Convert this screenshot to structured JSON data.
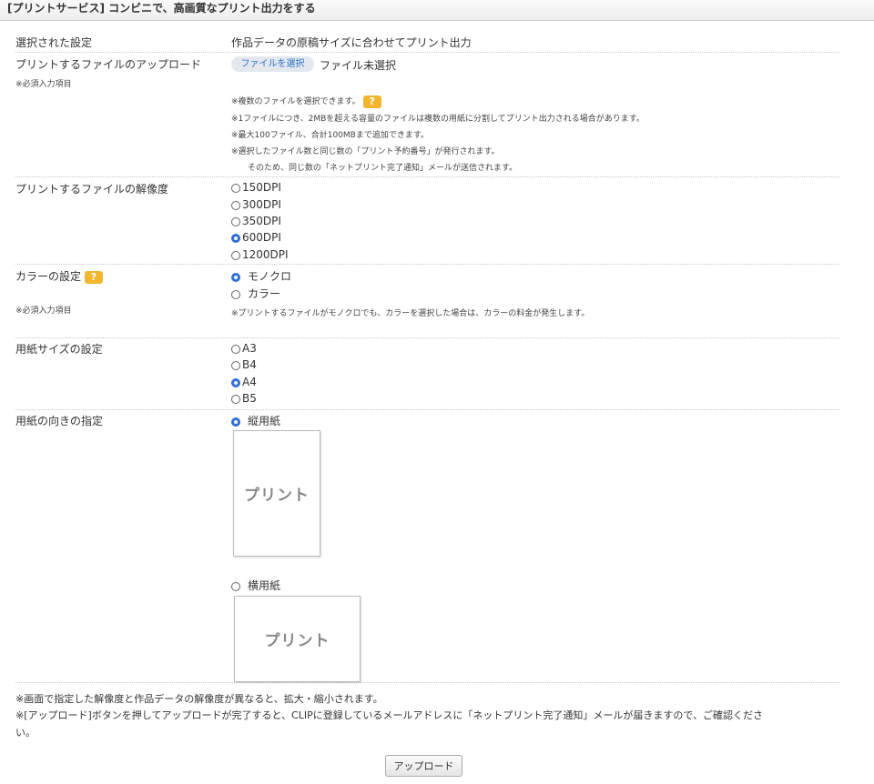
{
  "header": {
    "title": "[プリントサービス] コンビニで、高画質なプリント出力をする"
  },
  "selected_setting": {
    "label": "選択された設定",
    "value": "作品データの原稿サイズに合わせてプリント出力"
  },
  "upload_file": {
    "label": "プリントするファイルのアップロード",
    "required": "※必須入力項目",
    "button_label": "ファイルを選択",
    "status": "ファイル未選択",
    "notes": [
      "※複数のファイルを選択できます。",
      "※1ファイルにつき、2MBを超える容量のファイルは複数の用紙に分割してプリント出力される場合があります。",
      "※最大100ファイル、合計100MBまで追加できます。",
      "※選択したファイル数と同じ数の「プリント予約番号」が発行されます。",
      "そのため、同じ数の「ネットプリント完了通知」メールが送信されます。"
    ],
    "help_icon": "?"
  },
  "resolution": {
    "label": "プリントするファイルの解像度",
    "options": [
      "150DPI",
      "300DPI",
      "350DPI",
      "600DPI",
      "1200DPI"
    ],
    "selected": "600DPI"
  },
  "color": {
    "label": "カラーの設定",
    "help_icon": "?",
    "required": "※必須入力項目",
    "options": [
      "モノクロ",
      "カラー"
    ],
    "selected": "モノクロ",
    "note": "※プリントするファイルがモノクロでも、カラーを選択した場合は、カラーの料金が発生します。"
  },
  "paper_size": {
    "label": "用紙サイズの設定",
    "options": [
      "A3",
      "B4",
      "A4",
      "B5"
    ],
    "selected": "A4"
  },
  "orientation": {
    "label": "用紙の向きの指定",
    "options": [
      "縦用紙",
      "横用紙"
    ],
    "selected": "縦用紙",
    "preview_text": "プリント"
  },
  "bottom_notes": [
    "※画面で指定した解像度と作品データの解像度が異なると、拡大・縮小されます。",
    "※[アップロード]ボタンを押してアップロードが完了すると、CLIPに登録しているメールアドレスに「ネットプリント完了通知」メールが届きますので、ご確認くださ",
    "い。"
  ],
  "upload_button": "アップロード",
  "colors": {
    "accent": "#2e6fd9",
    "help_badge": "#f2b52e",
    "file_button_bg": "#e3e8ef"
  }
}
